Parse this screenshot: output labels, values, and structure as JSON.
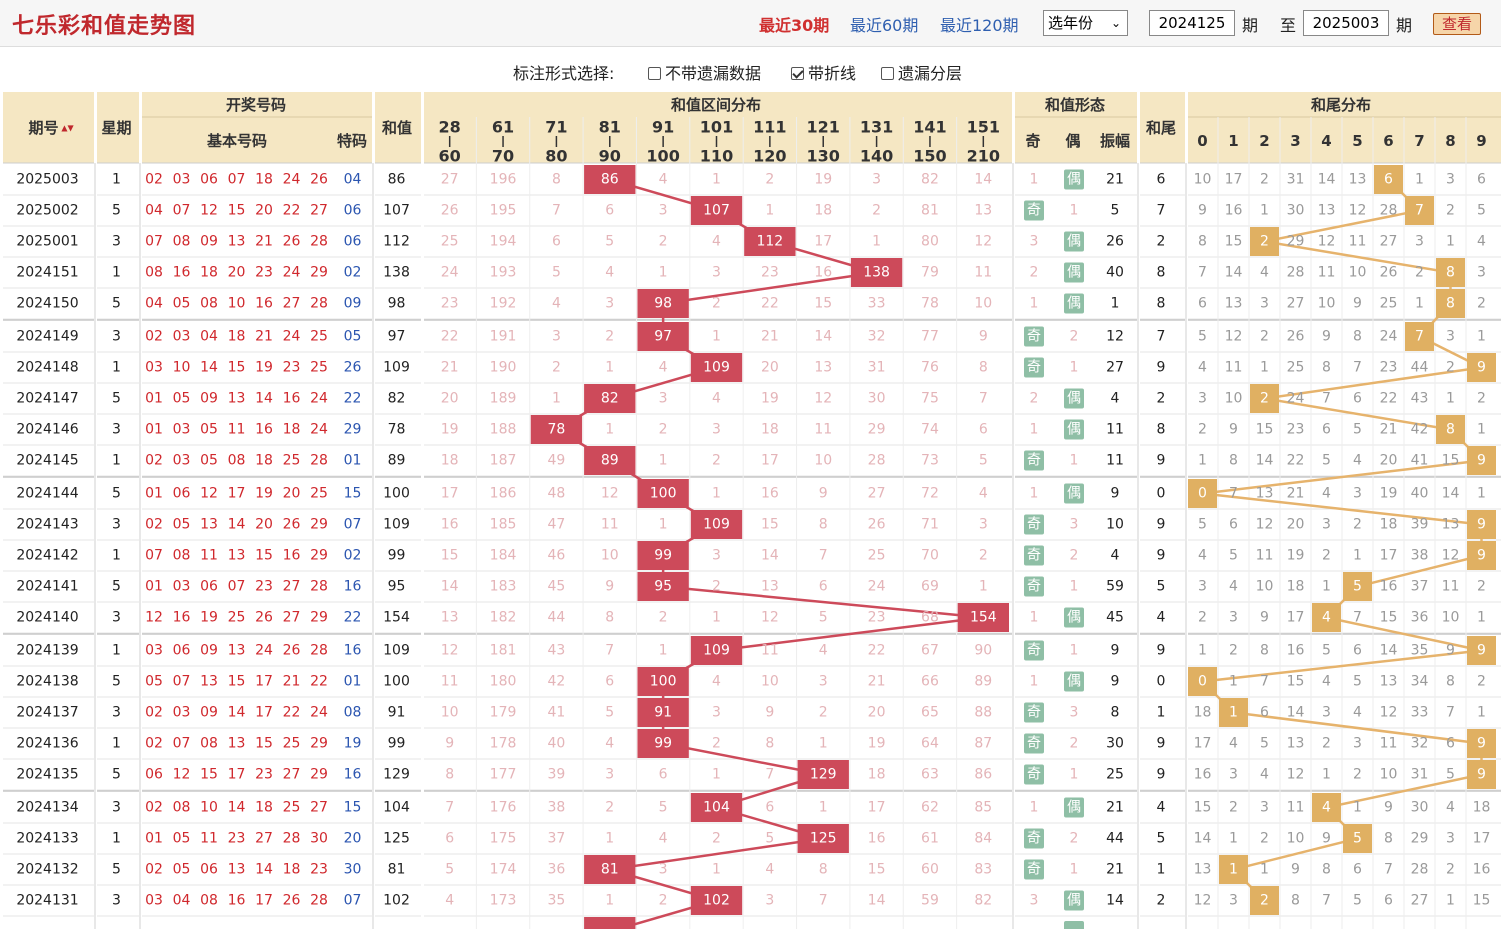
{
  "header": {
    "title": "七乐彩和值走势图",
    "period_links": [
      "最近30期",
      "最近60期",
      "最近120期"
    ],
    "active_period": 0,
    "year_select": "选年份",
    "start_issue": "2024125",
    "issue_unit": "期",
    "to_label": "至",
    "end_issue": "2025003",
    "view_button": "查看"
  },
  "options": {
    "label": "标注形式选择:",
    "items": [
      {
        "label": "不带遗漏数据",
        "checked": false
      },
      {
        "label": "带折线",
        "checked": true
      },
      {
        "label": "遗漏分层",
        "checked": false
      }
    ]
  },
  "table_headers": {
    "issue": "期号",
    "sort_icon": "▲▼",
    "weekday": "星期",
    "draw_numbers": "开奖号码",
    "basic": "基本号码",
    "special": "特码",
    "sum": "和值",
    "range_dist": "和值区间分布",
    "ranges": [
      [
        "28",
        "60"
      ],
      [
        "61",
        "70"
      ],
      [
        "71",
        "80"
      ],
      [
        "81",
        "90"
      ],
      [
        "91",
        "100"
      ],
      [
        "101",
        "110"
      ],
      [
        "111",
        "120"
      ],
      [
        "121",
        "130"
      ],
      [
        "131",
        "140"
      ],
      [
        "141",
        "150"
      ],
      [
        "151",
        "210"
      ]
    ],
    "form": "和值形态",
    "odd": "奇",
    "even": "偶",
    "amplitude": "振幅",
    "tail": "和尾",
    "tail_dist": "和尾分布",
    "tail_digits": [
      "0",
      "1",
      "2",
      "3",
      "4",
      "5",
      "6",
      "7",
      "8",
      "9"
    ]
  },
  "colors": {
    "range_hit": "#cd4a5a",
    "tail_hit": "#e0b062",
    "odd_badge": "#8fbfa6",
    "even_badge": "#8fbfa6",
    "header_bg": "#f5e7c3",
    "trend_line_range": "#cd4a5a",
    "trend_line_tail": "#e6b36c"
  },
  "chart_data": {
    "type": "table",
    "rows": [
      {
        "issue": "2025003",
        "week": "1",
        "nums": [
          "02",
          "03",
          "06",
          "07",
          "18",
          "24",
          "26"
        ],
        "sp": "04",
        "sum": "86",
        "range": [
          "27",
          "196",
          "8",
          "86",
          "4",
          "1",
          "2",
          "19",
          "3",
          "82",
          "14"
        ],
        "hit": 3,
        "odd": "1",
        "even": "偶",
        "amp": "21",
        "tail": "6",
        "tails": [
          "10",
          "17",
          "2",
          "31",
          "14",
          "13",
          "6",
          "1",
          "3",
          "6"
        ]
      },
      {
        "issue": "2025002",
        "week": "5",
        "nums": [
          "04",
          "07",
          "12",
          "15",
          "20",
          "22",
          "27"
        ],
        "sp": "06",
        "sum": "107",
        "range": [
          "26",
          "195",
          "7",
          "6",
          "3",
          "107",
          "1",
          "18",
          "2",
          "81",
          "13"
        ],
        "hit": 5,
        "odd": "奇",
        "even": "1",
        "amp": "5",
        "tail": "7",
        "tails": [
          "9",
          "16",
          "1",
          "30",
          "13",
          "12",
          "28",
          "7",
          "2",
          "5"
        ]
      },
      {
        "issue": "2025001",
        "week": "3",
        "nums": [
          "07",
          "08",
          "09",
          "13",
          "21",
          "26",
          "28"
        ],
        "sp": "06",
        "sum": "112",
        "range": [
          "25",
          "194",
          "6",
          "5",
          "2",
          "4",
          "112",
          "17",
          "1",
          "80",
          "12"
        ],
        "hit": 6,
        "odd": "3",
        "even": "偶",
        "amp": "26",
        "tail": "2",
        "tails": [
          "8",
          "15",
          "2",
          "29",
          "12",
          "11",
          "27",
          "3",
          "1",
          "4"
        ]
      },
      {
        "issue": "2024151",
        "week": "1",
        "nums": [
          "08",
          "16",
          "18",
          "20",
          "23",
          "24",
          "29"
        ],
        "sp": "02",
        "sum": "138",
        "range": [
          "24",
          "193",
          "5",
          "4",
          "1",
          "3",
          "23",
          "16",
          "138",
          "79",
          "11"
        ],
        "hit": 8,
        "odd": "2",
        "even": "偶",
        "amp": "40",
        "tail": "8",
        "tails": [
          "7",
          "14",
          "4",
          "28",
          "11",
          "10",
          "26",
          "2",
          "8",
          "3"
        ]
      },
      {
        "issue": "2024150",
        "week": "5",
        "nums": [
          "04",
          "05",
          "08",
          "10",
          "16",
          "27",
          "28"
        ],
        "sp": "09",
        "sum": "98",
        "range": [
          "23",
          "192",
          "4",
          "3",
          "98",
          "2",
          "22",
          "15",
          "33",
          "78",
          "10"
        ],
        "hit": 4,
        "odd": "1",
        "even": "偶",
        "amp": "1",
        "tail": "8",
        "tails": [
          "6",
          "13",
          "3",
          "27",
          "10",
          "9",
          "25",
          "1",
          "8",
          "2"
        ]
      },
      {
        "issue": "2024149",
        "week": "3",
        "nums": [
          "02",
          "03",
          "04",
          "18",
          "21",
          "24",
          "25"
        ],
        "sp": "05",
        "sum": "97",
        "range": [
          "22",
          "191",
          "3",
          "2",
          "97",
          "1",
          "21",
          "14",
          "32",
          "77",
          "9"
        ],
        "hit": 4,
        "odd": "奇",
        "even": "2",
        "amp": "12",
        "tail": "7",
        "tails": [
          "5",
          "12",
          "2",
          "26",
          "9",
          "8",
          "24",
          "7",
          "3",
          "1"
        ]
      },
      {
        "issue": "2024148",
        "week": "1",
        "nums": [
          "03",
          "10",
          "14",
          "15",
          "19",
          "23",
          "25"
        ],
        "sp": "26",
        "sum": "109",
        "range": [
          "21",
          "190",
          "2",
          "1",
          "4",
          "109",
          "20",
          "13",
          "31",
          "76",
          "8"
        ],
        "hit": 5,
        "odd": "奇",
        "even": "1",
        "amp": "27",
        "tail": "9",
        "tails": [
          "4",
          "11",
          "1",
          "25",
          "8",
          "7",
          "23",
          "44",
          "2",
          "9"
        ]
      },
      {
        "issue": "2024147",
        "week": "5",
        "nums": [
          "01",
          "05",
          "09",
          "13",
          "14",
          "16",
          "24"
        ],
        "sp": "22",
        "sum": "82",
        "range": [
          "20",
          "189",
          "1",
          "82",
          "3",
          "4",
          "19",
          "12",
          "30",
          "75",
          "7"
        ],
        "hit": 3,
        "odd": "2",
        "even": "偶",
        "amp": "4",
        "tail": "2",
        "tails": [
          "3",
          "10",
          "2",
          "24",
          "7",
          "6",
          "22",
          "43",
          "1",
          "2"
        ]
      },
      {
        "issue": "2024146",
        "week": "3",
        "nums": [
          "01",
          "03",
          "05",
          "11",
          "16",
          "18",
          "24"
        ],
        "sp": "29",
        "sum": "78",
        "range": [
          "19",
          "188",
          "78",
          "1",
          "2",
          "3",
          "18",
          "11",
          "29",
          "74",
          "6"
        ],
        "hit": 2,
        "odd": "1",
        "even": "偶",
        "amp": "11",
        "tail": "8",
        "tails": [
          "2",
          "9",
          "15",
          "23",
          "6",
          "5",
          "21",
          "42",
          "8",
          "1"
        ]
      },
      {
        "issue": "2024145",
        "week": "1",
        "nums": [
          "02",
          "03",
          "05",
          "08",
          "18",
          "25",
          "28"
        ],
        "sp": "01",
        "sum": "89",
        "range": [
          "18",
          "187",
          "49",
          "89",
          "1",
          "2",
          "17",
          "10",
          "28",
          "73",
          "5"
        ],
        "hit": 3,
        "odd": "奇",
        "even": "1",
        "amp": "11",
        "tail": "9",
        "tails": [
          "1",
          "8",
          "14",
          "22",
          "5",
          "4",
          "20",
          "41",
          "15",
          "9"
        ]
      },
      {
        "issue": "2024144",
        "week": "5",
        "nums": [
          "01",
          "06",
          "12",
          "17",
          "19",
          "20",
          "25"
        ],
        "sp": "15",
        "sum": "100",
        "range": [
          "17",
          "186",
          "48",
          "12",
          "100",
          "1",
          "16",
          "9",
          "27",
          "72",
          "4"
        ],
        "hit": 4,
        "odd": "1",
        "even": "偶",
        "amp": "9",
        "tail": "0",
        "tails": [
          "0",
          "7",
          "13",
          "21",
          "4",
          "3",
          "19",
          "40",
          "14",
          "1"
        ]
      },
      {
        "issue": "2024143",
        "week": "3",
        "nums": [
          "02",
          "05",
          "13",
          "14",
          "20",
          "26",
          "29"
        ],
        "sp": "07",
        "sum": "109",
        "range": [
          "16",
          "185",
          "47",
          "11",
          "1",
          "109",
          "15",
          "8",
          "26",
          "71",
          "3"
        ],
        "hit": 5,
        "odd": "奇",
        "even": "3",
        "amp": "10",
        "tail": "9",
        "tails": [
          "5",
          "6",
          "12",
          "20",
          "3",
          "2",
          "18",
          "39",
          "13",
          "9"
        ]
      },
      {
        "issue": "2024142",
        "week": "1",
        "nums": [
          "07",
          "08",
          "11",
          "13",
          "15",
          "16",
          "29"
        ],
        "sp": "02",
        "sum": "99",
        "range": [
          "15",
          "184",
          "46",
          "10",
          "99",
          "3",
          "14",
          "7",
          "25",
          "70",
          "2"
        ],
        "hit": 4,
        "odd": "奇",
        "even": "2",
        "amp": "4",
        "tail": "9",
        "tails": [
          "4",
          "5",
          "11",
          "19",
          "2",
          "1",
          "17",
          "38",
          "12",
          "9"
        ]
      },
      {
        "issue": "2024141",
        "week": "5",
        "nums": [
          "01",
          "03",
          "06",
          "07",
          "23",
          "27",
          "28"
        ],
        "sp": "16",
        "sum": "95",
        "range": [
          "14",
          "183",
          "45",
          "9",
          "95",
          "2",
          "13",
          "6",
          "24",
          "69",
          "1"
        ],
        "hit": 4,
        "odd": "奇",
        "even": "1",
        "amp": "59",
        "tail": "5",
        "tails": [
          "3",
          "4",
          "10",
          "18",
          "1",
          "5",
          "16",
          "37",
          "11",
          "2"
        ]
      },
      {
        "issue": "2024140",
        "week": "3",
        "nums": [
          "12",
          "16",
          "19",
          "25",
          "26",
          "27",
          "29"
        ],
        "sp": "22",
        "sum": "154",
        "range": [
          "13",
          "182",
          "44",
          "8",
          "2",
          "1",
          "12",
          "5",
          "23",
          "68",
          "154"
        ],
        "hit": 10,
        "odd": "1",
        "even": "偶",
        "amp": "45",
        "tail": "4",
        "tails": [
          "2",
          "3",
          "9",
          "17",
          "4",
          "7",
          "15",
          "36",
          "10",
          "1"
        ]
      },
      {
        "issue": "2024139",
        "week": "1",
        "nums": [
          "03",
          "06",
          "09",
          "13",
          "24",
          "26",
          "28"
        ],
        "sp": "16",
        "sum": "109",
        "range": [
          "12",
          "181",
          "43",
          "7",
          "1",
          "109",
          "11",
          "4",
          "22",
          "67",
          "90"
        ],
        "hit": 5,
        "odd": "奇",
        "even": "1",
        "amp": "9",
        "tail": "9",
        "tails": [
          "1",
          "2",
          "8",
          "16",
          "5",
          "6",
          "14",
          "35",
          "9",
          "9"
        ]
      },
      {
        "issue": "2024138",
        "week": "5",
        "nums": [
          "05",
          "07",
          "13",
          "15",
          "17",
          "21",
          "22"
        ],
        "sp": "01",
        "sum": "100",
        "range": [
          "11",
          "180",
          "42",
          "6",
          "100",
          "4",
          "10",
          "3",
          "21",
          "66",
          "89"
        ],
        "hit": 4,
        "odd": "1",
        "even": "偶",
        "amp": "9",
        "tail": "0",
        "tails": [
          "0",
          "1",
          "7",
          "15",
          "4",
          "5",
          "13",
          "34",
          "8",
          "2"
        ]
      },
      {
        "issue": "2024137",
        "week": "3",
        "nums": [
          "02",
          "03",
          "09",
          "14",
          "17",
          "22",
          "24"
        ],
        "sp": "08",
        "sum": "91",
        "range": [
          "10",
          "179",
          "41",
          "5",
          "91",
          "3",
          "9",
          "2",
          "20",
          "65",
          "88"
        ],
        "hit": 4,
        "odd": "奇",
        "even": "3",
        "amp": "8",
        "tail": "1",
        "tails": [
          "18",
          "1",
          "6",
          "14",
          "3",
          "4",
          "12",
          "33",
          "7",
          "1"
        ]
      },
      {
        "issue": "2024136",
        "week": "1",
        "nums": [
          "02",
          "07",
          "08",
          "13",
          "15",
          "25",
          "29"
        ],
        "sp": "19",
        "sum": "99",
        "range": [
          "9",
          "178",
          "40",
          "4",
          "99",
          "2",
          "8",
          "1",
          "19",
          "64",
          "87"
        ],
        "hit": 4,
        "odd": "奇",
        "even": "2",
        "amp": "30",
        "tail": "9",
        "tails": [
          "17",
          "4",
          "5",
          "13",
          "2",
          "3",
          "11",
          "32",
          "6",
          "9"
        ]
      },
      {
        "issue": "2024135",
        "week": "5",
        "nums": [
          "06",
          "12",
          "15",
          "17",
          "23",
          "27",
          "29"
        ],
        "sp": "16",
        "sum": "129",
        "range": [
          "8",
          "177",
          "39",
          "3",
          "6",
          "1",
          "7",
          "129",
          "18",
          "63",
          "86"
        ],
        "hit": 7,
        "odd": "奇",
        "even": "1",
        "amp": "25",
        "tail": "9",
        "tails": [
          "16",
          "3",
          "4",
          "12",
          "1",
          "2",
          "10",
          "31",
          "5",
          "9"
        ]
      },
      {
        "issue": "2024134",
        "week": "3",
        "nums": [
          "02",
          "08",
          "10",
          "14",
          "18",
          "25",
          "27"
        ],
        "sp": "15",
        "sum": "104",
        "range": [
          "7",
          "176",
          "38",
          "2",
          "5",
          "104",
          "6",
          "1",
          "17",
          "62",
          "85"
        ],
        "hit": 5,
        "odd": "1",
        "even": "偶",
        "amp": "21",
        "tail": "4",
        "tails": [
          "15",
          "2",
          "3",
          "11",
          "4",
          "1",
          "9",
          "30",
          "4",
          "18"
        ]
      },
      {
        "issue": "2024133",
        "week": "1",
        "nums": [
          "01",
          "05",
          "11",
          "23",
          "27",
          "28",
          "30"
        ],
        "sp": "20",
        "sum": "125",
        "range": [
          "6",
          "175",
          "37",
          "1",
          "4",
          "2",
          "5",
          "125",
          "16",
          "61",
          "84"
        ],
        "hit": 7,
        "odd": "奇",
        "even": "2",
        "amp": "44",
        "tail": "5",
        "tails": [
          "14",
          "1",
          "2",
          "10",
          "9",
          "5",
          "8",
          "29",
          "3",
          "17"
        ]
      },
      {
        "issue": "2024132",
        "week": "5",
        "nums": [
          "02",
          "05",
          "06",
          "13",
          "14",
          "18",
          "23"
        ],
        "sp": "30",
        "sum": "81",
        "range": [
          "5",
          "174",
          "36",
          "81",
          "3",
          "1",
          "4",
          "8",
          "15",
          "60",
          "83"
        ],
        "hit": 3,
        "odd": "奇",
        "even": "1",
        "amp": "21",
        "tail": "1",
        "tails": [
          "13",
          "1",
          "1",
          "9",
          "8",
          "6",
          "7",
          "28",
          "2",
          "16"
        ]
      },
      {
        "issue": "2024131",
        "week": "3",
        "nums": [
          "03",
          "04",
          "08",
          "16",
          "17",
          "26",
          "28"
        ],
        "sp": "07",
        "sum": "102",
        "range": [
          "4",
          "173",
          "35",
          "1",
          "2",
          "102",
          "3",
          "7",
          "14",
          "59",
          "82"
        ],
        "hit": 5,
        "odd": "3",
        "even": "偶",
        "amp": "14",
        "tail": "2",
        "tails": [
          "12",
          "3",
          "2",
          "8",
          "7",
          "5",
          "6",
          "27",
          "1",
          "15"
        ]
      }
    ],
    "partial_row": {
      "hit": 3
    }
  }
}
